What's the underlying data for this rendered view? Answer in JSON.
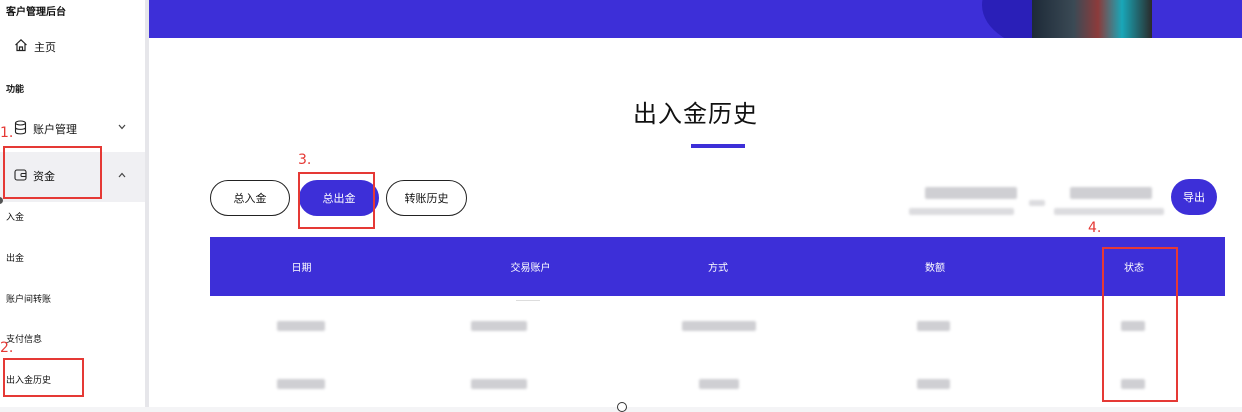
{
  "sidebar": {
    "brand": "客户管理后台",
    "home_label": "主页",
    "section_label": "功能",
    "account_mgmt_label": "账户管理",
    "funds_label": "资金",
    "sub_items": [
      "入金",
      "出金",
      "账户间转账",
      "支付信息",
      "出入金历史"
    ]
  },
  "annotations": [
    "1.",
    "2.",
    "3.",
    "4."
  ],
  "main": {
    "title": "出入金历史",
    "tabs": [
      "总入金",
      "总出金",
      "转账历史"
    ],
    "active_tab": "总出金",
    "export_label": "导出",
    "table": {
      "headers": [
        "日期",
        "交易账户",
        "方式",
        "数额",
        "状态"
      ]
    }
  },
  "colors": {
    "accent": "#3d2fd8",
    "annotation": "#e53935"
  },
  "icons": [
    "home-icon",
    "database-icon",
    "wallet-icon",
    "chevron-down-icon",
    "chevron-up-icon"
  ]
}
